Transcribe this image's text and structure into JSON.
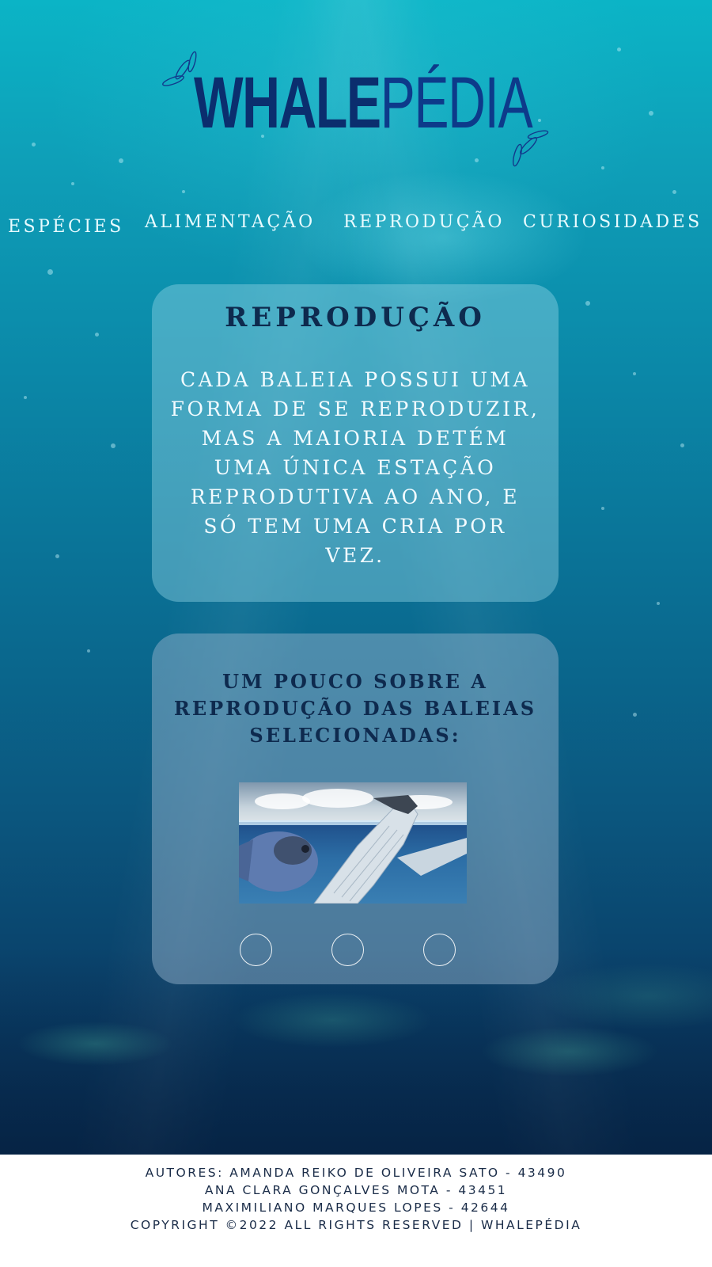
{
  "logo": {
    "bold": "WHALE",
    "light": "PÉDIA"
  },
  "nav": {
    "items": [
      {
        "label": "ESPÉCIES"
      },
      {
        "label": "ALIMENTAÇÃO"
      },
      {
        "label": "REPRODUÇÃO"
      },
      {
        "label": "CURIOSIDADES"
      }
    ]
  },
  "intro": {
    "title": "REPRODUÇÃO",
    "lines": [
      "CADA BALEIA POSSUI UMA",
      "FORMA DE SE REPRODUZIR,",
      "MAS A MAIORIA DETÉM",
      "UMA ÚNICA ESTAÇÃO",
      "REPRODUTIVA AO ANO, E",
      "SÓ TEM UMA CRIA POR",
      "VEZ."
    ]
  },
  "gallery": {
    "subtitle_lines": [
      "UM POUCO SOBRE A",
      "REPRODUÇÃO DAS BALEIAS",
      "SELECIONADAS:"
    ],
    "slide_count": 3
  },
  "footer": {
    "lines": [
      "AUTORES: AMANDA REIKO DE OLIVEIRA SATO - 43490",
      "ANA CLARA GONÇALVES MOTA - 43451",
      "MAXIMILIANO MARQUES LOPES - 42644",
      "COPYRIGHT ©2022 ALL RIGHTS RESERVED | WHALEPÉDIA"
    ]
  },
  "colors": {
    "logo": "#0b2e6e",
    "nav_text": "#e8fbff",
    "heading_text": "#0e2a4e",
    "footer_text": "#1a2c48"
  }
}
